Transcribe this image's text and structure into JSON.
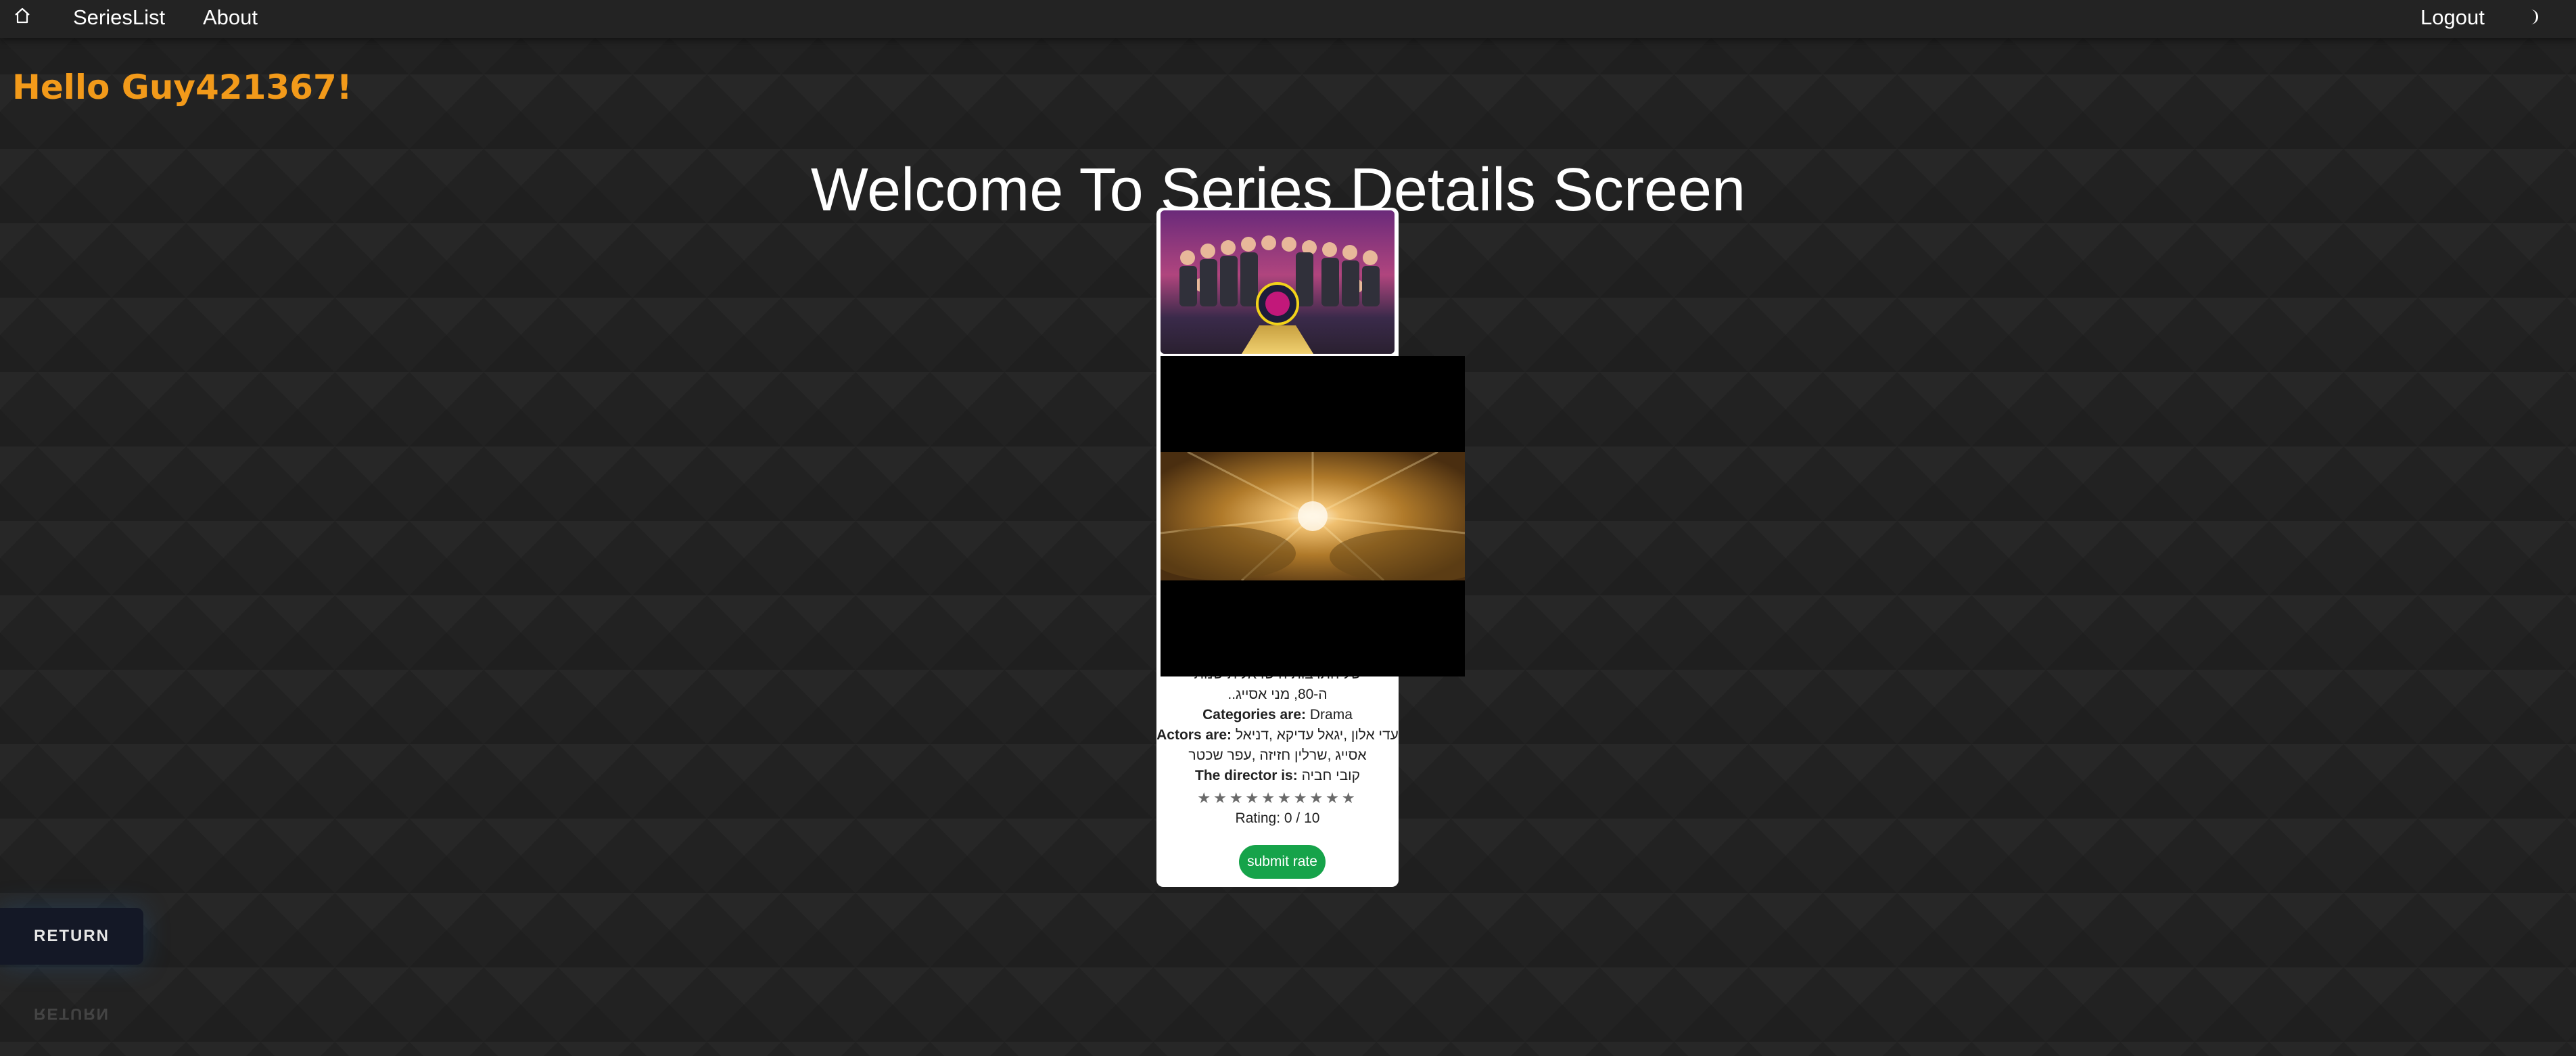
{
  "nav": {
    "home_icon": "home-icon",
    "serieslist": "SeriesList",
    "about": "About",
    "logout": "Logout",
    "theme_icon": "moon-icon"
  },
  "greeting": "Hello Guy421367!",
  "page_title": "Welcome To Series Details Screen",
  "series": {
    "description_tail_1": "של התרבות הישראלית שנות",
    "description_tail_2": "ה-80, מני אסייג..",
    "categories_label": "Categories are:",
    "categories_value": "Drama",
    "actors_label": "Actors are:",
    "actors_value_1": "עדי אלון ,יגאל עדיקא ,דניאל",
    "actors_value_2": "אסייג ,שרלין חזיזה ,עפר שכטר",
    "director_label": "The director is:",
    "director_value": "קובי חביה",
    "stars": "★★★★★★★★★★",
    "rating_text": "Rating: 0 / 10",
    "submit_label": "submit rate"
  },
  "return": {
    "label": "RETURN"
  },
  "colors": {
    "accent": "#f29a1a",
    "submit": "#16a34a"
  }
}
